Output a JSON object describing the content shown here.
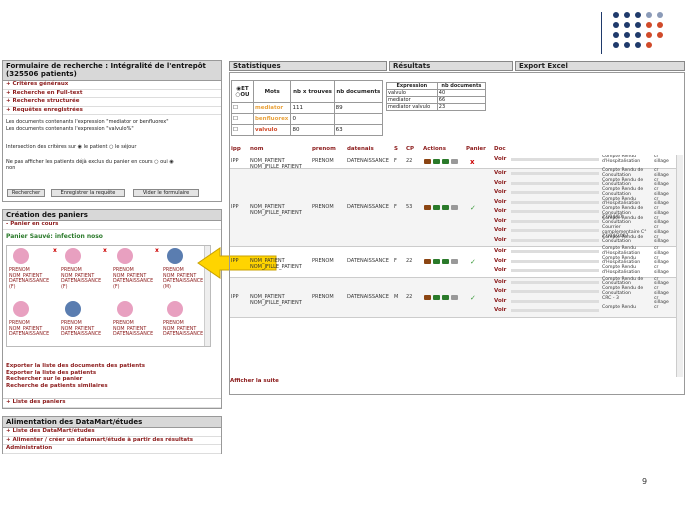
{
  "page_number": "9",
  "search": {
    "title": "Formulaire de recherche : Intégralité de l'entrepôt (325506 patients)",
    "links": [
      "+ Critères généraux",
      "+ Recherche en Full-text",
      "+ Recherche structurée",
      "+ Requêtes enregistrées"
    ],
    "desc1": "Les documents contenants l'expression \"mediator or benfluorex\"",
    "desc2": "Les documents contenants l'expression \"valvulo%\"",
    "intersect_label": "Intersection des critères sur",
    "opt_patient": "le patient",
    "opt_sejour": "le séjour",
    "exclude_label": "Ne pas afficher les patients déjà exclus du panier en cours",
    "opt_non": "non",
    "opt_oui": "oui",
    "btn_search": "Rechercher",
    "btn_save": "Enregistrer la requête",
    "btn_clear": "Vider le formulaire"
  },
  "baskets": {
    "title": "Création des paniers",
    "current": "- Panier en cours",
    "saved": "Panier Sauvé: infection noso",
    "patients": [
      {
        "l1": "PRENOM",
        "l2": "NOM_PATIENT",
        "l3": "DATENAISSANCE",
        "l4": "(F)",
        "g": "f"
      },
      {
        "l1": "PRENOM",
        "l2": "NOM_PATIENT",
        "l3": "DATENAISSANCE",
        "l4": "(F)",
        "g": "f"
      },
      {
        "l1": "PRENOM",
        "l2": "NOM_PATIENT",
        "l3": "DATENAISSANCE",
        "l4": "(F)",
        "g": "f"
      },
      {
        "l1": "PRENOM",
        "l2": "NOM_PATIENT",
        "l3": "DATENAISSANCE",
        "l4": "(M)",
        "g": "m"
      }
    ],
    "x": "x",
    "actions": [
      "Exporter la liste des documents des patients",
      "Exporter la liste des patients",
      "Rechercher sur le panier",
      "Recherche de patients similaires"
    ],
    "list": "+ Liste des paniers"
  },
  "datamart": {
    "title": "Alimentation des DataMart/études",
    "links": [
      "+ Liste des DataMart/études",
      "+ Alimenter / créer un datamart/étude à partir des résultats",
      "Administration"
    ]
  },
  "tabs": [
    "Statistiques",
    "Résultats",
    "Export Excel"
  ],
  "stats": {
    "h_et": "ET",
    "h_ou": "OU",
    "h_mots": "Mots",
    "h_nb_x": "nb x trouves",
    "h_nb_doc": "nb documents",
    "rows": [
      {
        "mot": "mediator",
        "nbx": "111",
        "nbd": "89",
        "color": "#e9a23b"
      },
      {
        "mot": "benfluorex",
        "nbx": "0",
        "nbd": "",
        "color": "#e9a23b"
      },
      {
        "mot": "valvulo",
        "nbx": "80",
        "nbd": "63",
        "color": "#d04a2a"
      }
    ]
  },
  "expr": {
    "h1": "Expression",
    "h2": "nb documents",
    "rows": [
      {
        "e": "valvulo",
        "n": "40"
      },
      {
        "e": "mediator",
        "n": "66"
      },
      {
        "e": "mediator valvulo",
        "n": "23"
      }
    ]
  },
  "results": {
    "headers": [
      "ipp",
      "nom",
      "prenom",
      "datenais",
      "S",
      "CP",
      "Actions",
      "Panier",
      "Doc"
    ],
    "rows": [
      {
        "ipp": "IPP",
        "nom": "NOM_PATIENT NOM_JFILLE_PATIENT",
        "prenom": "PRENOM",
        "dn": "DATENAISSANCE",
        "s": "F",
        "cp": "22",
        "panier": "x",
        "docs": [
          {
            "t": "Compte Rendu d'Hospitalisation",
            "s": "cr sillage"
          }
        ]
      },
      {
        "ipp": "IPP",
        "nom": "NOM_PATIENT NOM_JFILLE_PATIENT",
        "prenom": "PRENOM",
        "dn": "DATENAISSANCE",
        "s": "F",
        "cp": "53",
        "panier": "✓",
        "docs": [
          {
            "t": "Compte Rendu de Consultation",
            "s": "cr sillage"
          },
          {
            "t": "Compte Rendu de Consultation",
            "s": "cr sillage"
          },
          {
            "t": "Compte Rendu de Consultation",
            "s": "cr sillage"
          },
          {
            "t": "Compte Rendu d'Hospitalisation",
            "s": "cr sillage"
          },
          {
            "t": "Compte Rendu de Consultation 27/04/07",
            "s": "cr sillage"
          },
          {
            "t": "Compte Rendu de Consultation",
            "s": "cr sillage"
          },
          {
            "t": "Courrier complementaire C° 27/04/2007",
            "s": "cr sillage"
          },
          {
            "t": "Compte Rendu de Consultation",
            "s": "cr sillage"
          }
        ]
      },
      {
        "ipp": "IPP",
        "nom": "NOM_PATIENT NOM_JFILLE_PATIENT",
        "prenom": "PRENOM",
        "dn": "DATENAISSANCE",
        "s": "F",
        "cp": "22",
        "panier": "✓",
        "docs": [
          {
            "t": "Compte Rendu d'Hospitalisation",
            "s": "cr sillage"
          },
          {
            "t": "Compte Rendu d'Hospitalisation",
            "s": "cr sillage"
          },
          {
            "t": "Compte Rendu d'Hospitalisation",
            "s": "cr sillage"
          }
        ]
      },
      {
        "ipp": "IPP",
        "nom": "NOM_PATIENT NOM_JFILLE_PATIENT",
        "prenom": "PRENOM",
        "dn": "DATENAISSANCE",
        "s": "M",
        "cp": "22",
        "panier": "✓",
        "docs": [
          {
            "t": "Compte Rendu de Consultation",
            "s": "cr sillage"
          },
          {
            "t": "Compte Rendu de Consultation",
            "s": "cr sillage"
          },
          {
            "t": "CRC - 3",
            "s": "cr sillage"
          },
          {
            "t": "Compte Rendu",
            "s": "cr"
          }
        ]
      }
    ],
    "voir": "Voir",
    "more": "Afficher la suite"
  }
}
